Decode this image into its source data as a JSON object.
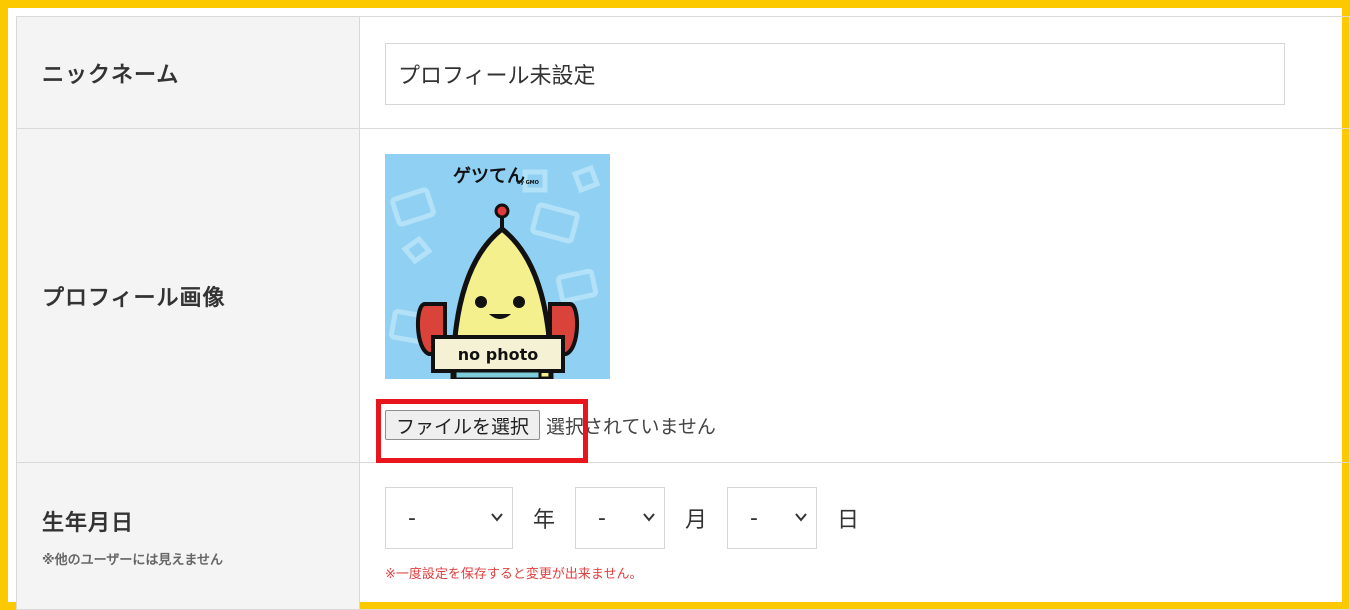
{
  "colors": {
    "frame_border": "#fcc800",
    "header_bg": "#f4f4f4",
    "highlight_box": "#e8161c",
    "warning_text": "#e04040"
  },
  "nickname": {
    "label": "ニックネーム",
    "value": "プロフィール未設定"
  },
  "profile_image": {
    "label": "プロフィール画像",
    "image": {
      "logo_text": "ゲツてん",
      "logo_sub": "by GMO",
      "sign_text": "no photo"
    },
    "file_button_label": "ファイルを選択",
    "file_status": "選択されていません"
  },
  "birthday": {
    "label": "生年月日",
    "note": "※他のユーザーには見えません",
    "year": {
      "value": "-",
      "unit": "年"
    },
    "month": {
      "value": "-",
      "unit": "月"
    },
    "day": {
      "value": "-",
      "unit": "日"
    },
    "warning": "※一度設定を保存すると変更が出来ません。"
  },
  "icons": [
    "chevron-down-icon"
  ]
}
